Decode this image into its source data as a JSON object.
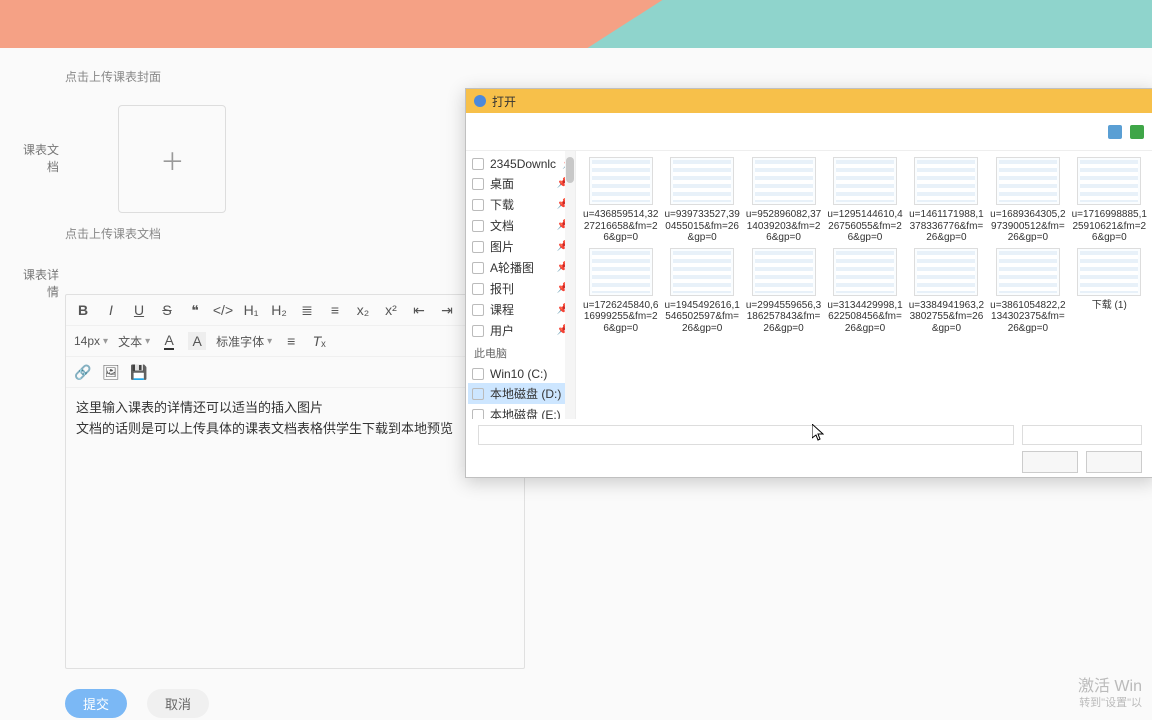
{
  "header": {
    "hint_cover": "点击上传课表封面",
    "hint_doc": "点击上传课表文档"
  },
  "labels": {
    "doc": "课表文档",
    "detail": "课表详情"
  },
  "editor": {
    "fontsize": "14px",
    "texttype": "文本",
    "fontfamily": "标准字体",
    "line1": "这里输入课表的详情还可以适当的插入图片",
    "line2": "文档的话则是可以上传具体的课表文档表格供学生下载到本地预览"
  },
  "buttons": {
    "submit": "提交",
    "cancel": "取消"
  },
  "dialog": {
    "title": "打开",
    "sidebar_quick": [
      "2345Downlc",
      "桌面",
      "下载",
      "文档",
      "图片",
      "A轮播图",
      "报刊",
      "课程",
      "用户"
    ],
    "sidebar_head": "此电脑",
    "sidebar_drives": [
      "Win10 (C:)",
      "本地磁盘 (D:)",
      "本地磁盘 (E:)"
    ],
    "selected_drive_index": 1,
    "files_row1": [
      "u=436859514,3227216658&fm=26&gp=0",
      "u=939733527,390455015&fm=26&gp=0",
      "u=952896082,3714039203&fm=26&gp=0",
      "u=1295144610,426756055&fm=26&gp=0",
      "u=1461171988,1378336776&fm=26&gp=0",
      "u=1689364305,2973900512&fm=26&gp=0",
      "u=1716998885,125910621&fm=26&gp=0"
    ],
    "files_row2": [
      "u=1726245840,616999255&fm=26&gp=0",
      "u=1945492616,1546502597&fm=26&gp=0",
      "u=2994559656,3186257843&fm=26&gp=0",
      "u=3134429998,1622508456&fm=26&gp=0",
      "u=3384941963,23802755&fm=26&gp=0",
      "u=3861054822,2134302375&fm=26&gp=0",
      "下载 (1)"
    ]
  },
  "watermark": {
    "main": "激活 Win",
    "sub": "转到\"设置\"以"
  }
}
